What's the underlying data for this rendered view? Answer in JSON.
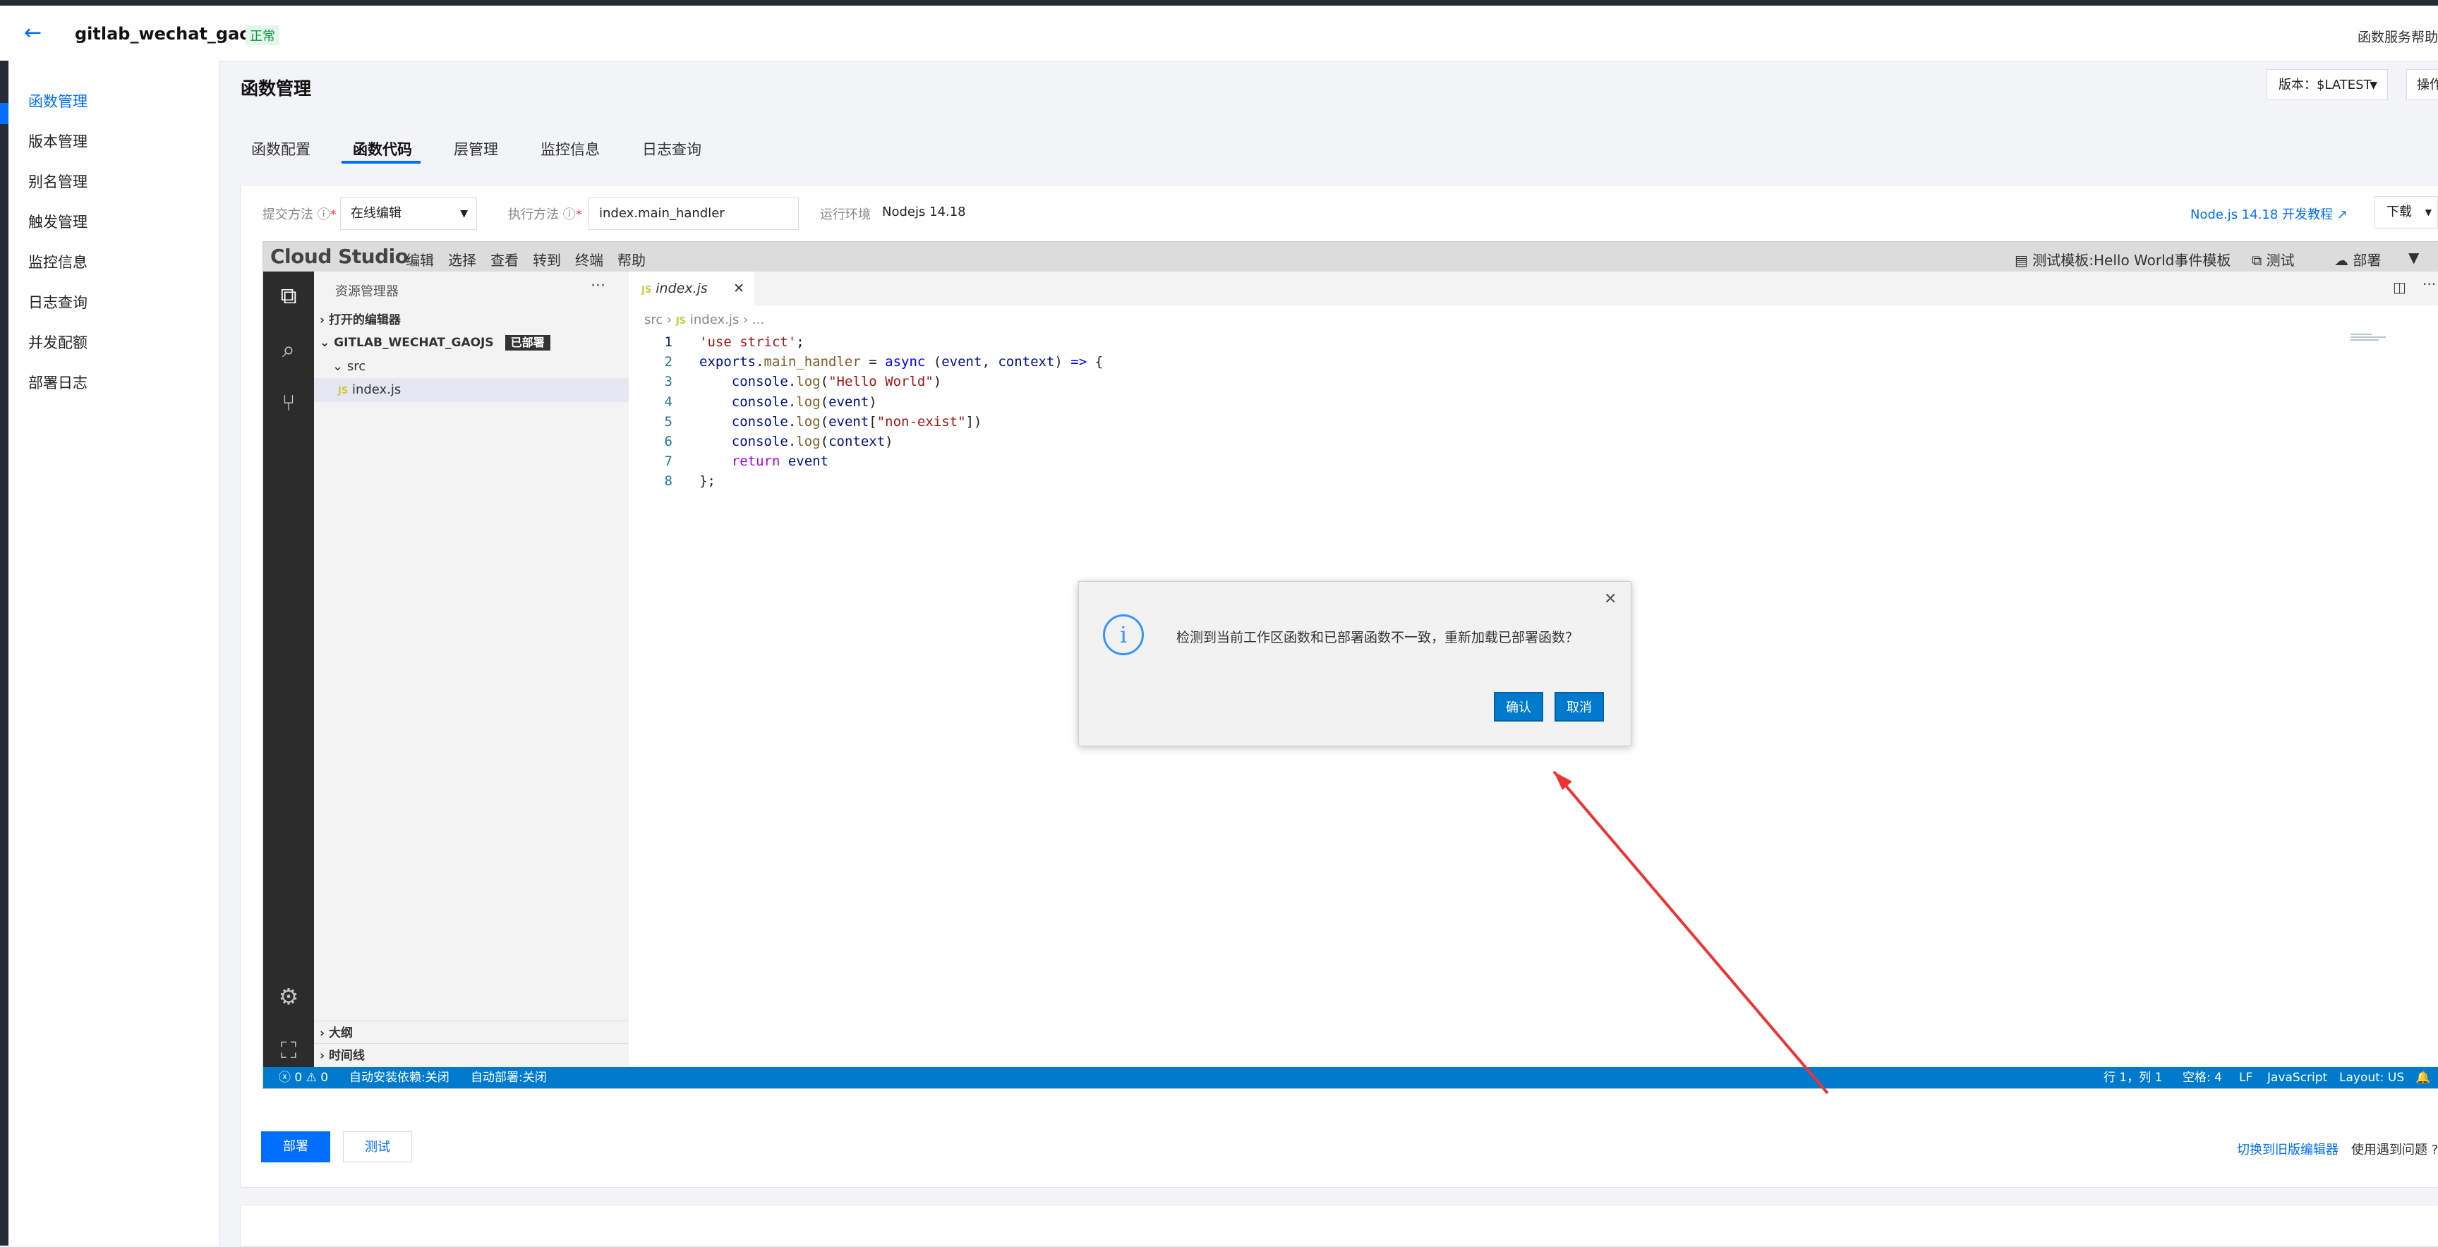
{
  "header": {
    "function_name": "gitlab_wechat_gaojs",
    "status": "正常",
    "help": "函数服务帮助"
  },
  "sidebar": {
    "items": [
      {
        "label": "函数管理",
        "active": true
      },
      {
        "label": "版本管理"
      },
      {
        "label": "别名管理"
      },
      {
        "label": "触发管理"
      },
      {
        "label": "监控信息"
      },
      {
        "label": "日志查询"
      },
      {
        "label": "并发配额"
      },
      {
        "label": "部署日志"
      }
    ]
  },
  "page": {
    "title": "函数管理",
    "version_label": "版本：$LATEST",
    "ops_label": "操作"
  },
  "tabs": [
    {
      "label": "函数配置"
    },
    {
      "label": "函数代码",
      "active": true
    },
    {
      "label": "层管理"
    },
    {
      "label": "监控信息"
    },
    {
      "label": "日志查询"
    }
  ],
  "form": {
    "submit_method_label": "提交方法",
    "submit_method_value": "在线编辑",
    "handler_label": "执行方法",
    "handler_value": "index.main_handler",
    "runtime_label": "运行环境",
    "runtime_value": "Nodejs 14.18",
    "docs_link": "Node.js 14.18 开发教程",
    "download": "下载"
  },
  "ide": {
    "logo": "Cloud Studio",
    "menu": [
      "编辑",
      "选择",
      "查看",
      "转到",
      "终端",
      "帮助"
    ],
    "template": "测试模板:Hello World事件模板",
    "test": "测试",
    "deploy": "部署",
    "explorer": {
      "title": "资源管理器",
      "open_editors": "打开的编辑器",
      "workspace": "GITLAB_WECHAT_GAOJS",
      "deployed_badge": "已部署",
      "folder": "src",
      "file": "index.js",
      "outline": "大纲",
      "timeline": "时间线"
    },
    "editor": {
      "tab": "index.js",
      "breadcrumb": [
        "src",
        "index.js",
        "..."
      ],
      "line_numbers": [
        "1",
        "2",
        "3",
        "4",
        "5",
        "6",
        "7",
        "8"
      ]
    },
    "status": {
      "problems": "0",
      "warnings": "0",
      "auto_install": "自动安装依赖:关闭",
      "auto_deploy": "自动部署:关闭",
      "position": "行 1，列 1",
      "spaces": "空格: 4",
      "eol": "LF",
      "language": "JavaScript",
      "layout": "Layout: US"
    }
  },
  "dialog": {
    "message": "检测到当前工作区函数和已部署函数不一致，重新加载已部署函数？",
    "confirm": "确认",
    "cancel": "取消"
  },
  "footer": {
    "deploy": "部署",
    "test": "测试",
    "switch_editor": "切换到旧版编辑器",
    "problem": "使用遇到问题"
  },
  "colors": {
    "accent": "#006eff",
    "ide_status": "#007acc",
    "arrow": "#ee3333"
  }
}
